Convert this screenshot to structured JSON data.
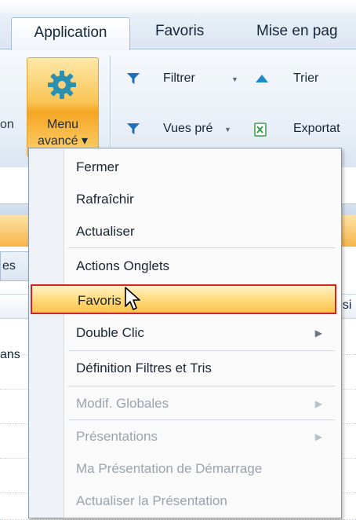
{
  "ribbon": {
    "tabs": [
      {
        "label": "Application",
        "active": true
      },
      {
        "label": "Favoris",
        "active": false
      },
      {
        "label": "Mise en pag",
        "active": false
      }
    ],
    "left_partial_label": "on",
    "menu_button": {
      "line1": "Menu",
      "line2": "avancé ▾",
      "icon": "gear-icon"
    },
    "filter": {
      "label": "Filtrer",
      "icon": "funnel-icon"
    },
    "sort": {
      "label": "Trier",
      "icon": "sort-up-icon"
    },
    "views": {
      "label": "Vues pré",
      "icon": "funnel-icon"
    },
    "export": {
      "label": "Exportat",
      "icon": "excel-icon"
    }
  },
  "background": {
    "left_tab": "es",
    "cell_left": "ans",
    "cell_right": "ési"
  },
  "menu": {
    "items": [
      {
        "label": "Fermer",
        "enabled": true
      },
      {
        "label": "Rafraîchir",
        "enabled": true
      },
      {
        "label": "Actualiser",
        "enabled": true
      },
      {
        "label": "Actions Onglets",
        "enabled": true
      },
      {
        "label": "Favoris",
        "enabled": true,
        "highlighted": true
      },
      {
        "label": "Double Clic",
        "enabled": true,
        "submenu": true
      },
      {
        "label": "Définition Filtres et Tris",
        "enabled": true
      },
      {
        "label": "Modif. Globales",
        "enabled": false,
        "submenu": true
      },
      {
        "label": "Présentations",
        "enabled": false,
        "submenu": true
      },
      {
        "label": "Ma Présentation de Démarrage",
        "enabled": false
      },
      {
        "label": "Actualiser la Présentation",
        "enabled": false
      }
    ]
  },
  "colors": {
    "highlight_border": "#d32222",
    "menu_button_orange": "#f5a623",
    "icon_blue": "#1d6fb8"
  }
}
